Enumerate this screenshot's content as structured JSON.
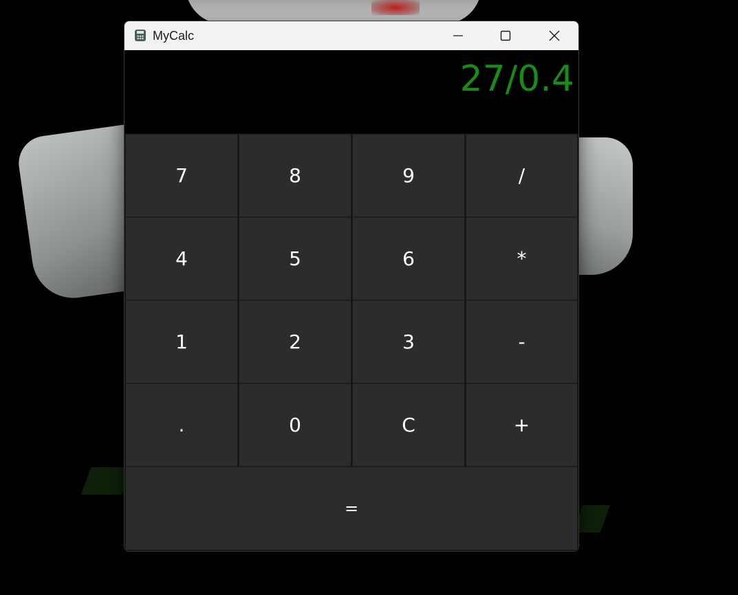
{
  "window": {
    "title": "MyCalc",
    "icon": "calculator-icon",
    "caption_buttons": [
      "minimize-icon",
      "maximize-icon",
      "close-icon"
    ]
  },
  "display": {
    "expression": "27/0.4",
    "color": "#1a8a1a"
  },
  "keypad": {
    "rows": [
      [
        "7",
        "8",
        "9",
        "/"
      ],
      [
        "4",
        "5",
        "6",
        "*"
      ],
      [
        "1",
        "2",
        "3",
        "-"
      ],
      [
        ".",
        "0",
        "C",
        "+"
      ]
    ],
    "equals": "=",
    "key_background": "#2c2c2c",
    "key_text_color": "#ffffff"
  }
}
